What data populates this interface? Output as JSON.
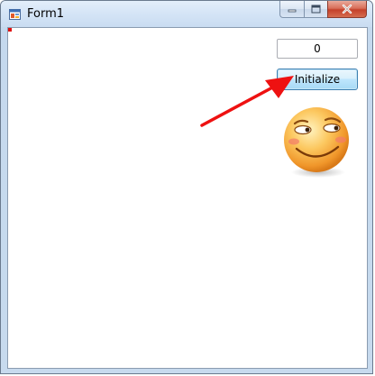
{
  "window": {
    "title": "Form1",
    "icon": "form-app-icon",
    "controls": {
      "minimize_icon": "minimize-icon",
      "maximize_icon": "maximize-icon",
      "close_icon": "close-icon"
    }
  },
  "form": {
    "counter_value": "0",
    "initialize_label": "Initialize"
  },
  "annotations": {
    "arrow_color": "#ee1111",
    "marker_color": "#e01010"
  },
  "decorations": {
    "emoji_icon": "smirk-emoji-icon"
  }
}
